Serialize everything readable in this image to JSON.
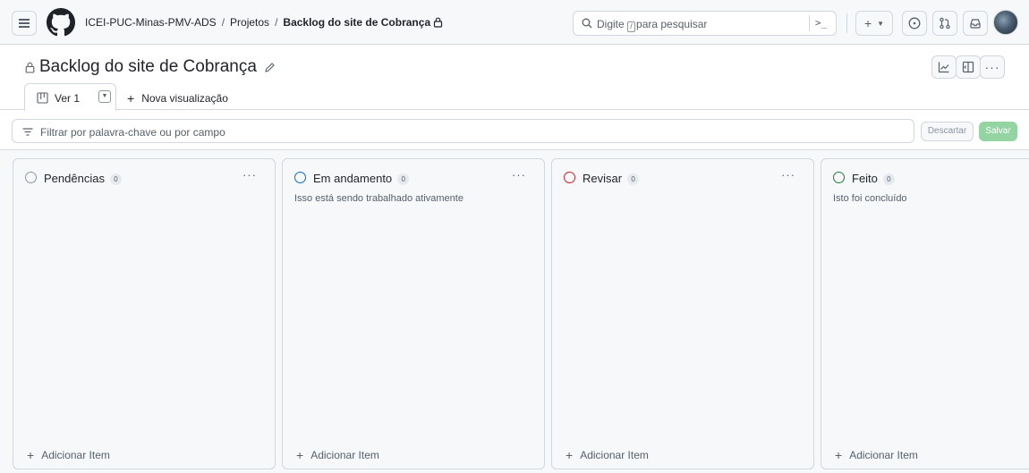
{
  "header": {
    "breadcrumb_org": "ICEI-PUC-Minas-PMV-ADS",
    "breadcrumb_sep": "/",
    "breadcrumb_projects": "Projetos",
    "breadcrumb_current": "Backlog do site de Cobrança",
    "search_placeholder_before": "Digite",
    "search_placeholder_key": "/",
    "search_placeholder_after": "para pesquisar",
    "command_palette_label": ">_",
    "create_label": "+",
    "icons": [
      "hamburger-icon",
      "github-logo-icon",
      "lock-icon",
      "search-icon",
      "command-palette-icon",
      "plus-icon",
      "issue-icon",
      "pull-request-icon",
      "inbox-icon"
    ]
  },
  "project": {
    "title": "Backlog do site de Cobrança",
    "tab_label": "Ver 1",
    "new_view_label": "Nova visualização",
    "filter_placeholder": "Filtrar por palavra-chave ou por campo",
    "discard_label": "Descartar",
    "save_label": "Salvar"
  },
  "columns": [
    {
      "name": "Pendências",
      "count": "0",
      "description": "",
      "status_color": "#8c959f",
      "add_label": "Adicionar Item"
    },
    {
      "name": "Em andamento",
      "count": "0",
      "description": "Isso está sendo trabalhado ativamente",
      "status_color": "#0969da",
      "add_label": "Adicionar Item"
    },
    {
      "name": "Revisar",
      "count": "0",
      "description": "",
      "status_color": "#cf222e",
      "add_label": "Adicionar Item"
    },
    {
      "name": "Feito",
      "count": "0",
      "description": "Isto foi concluído",
      "status_color": "#1a7f37",
      "add_label": "Adicionar Item"
    }
  ]
}
